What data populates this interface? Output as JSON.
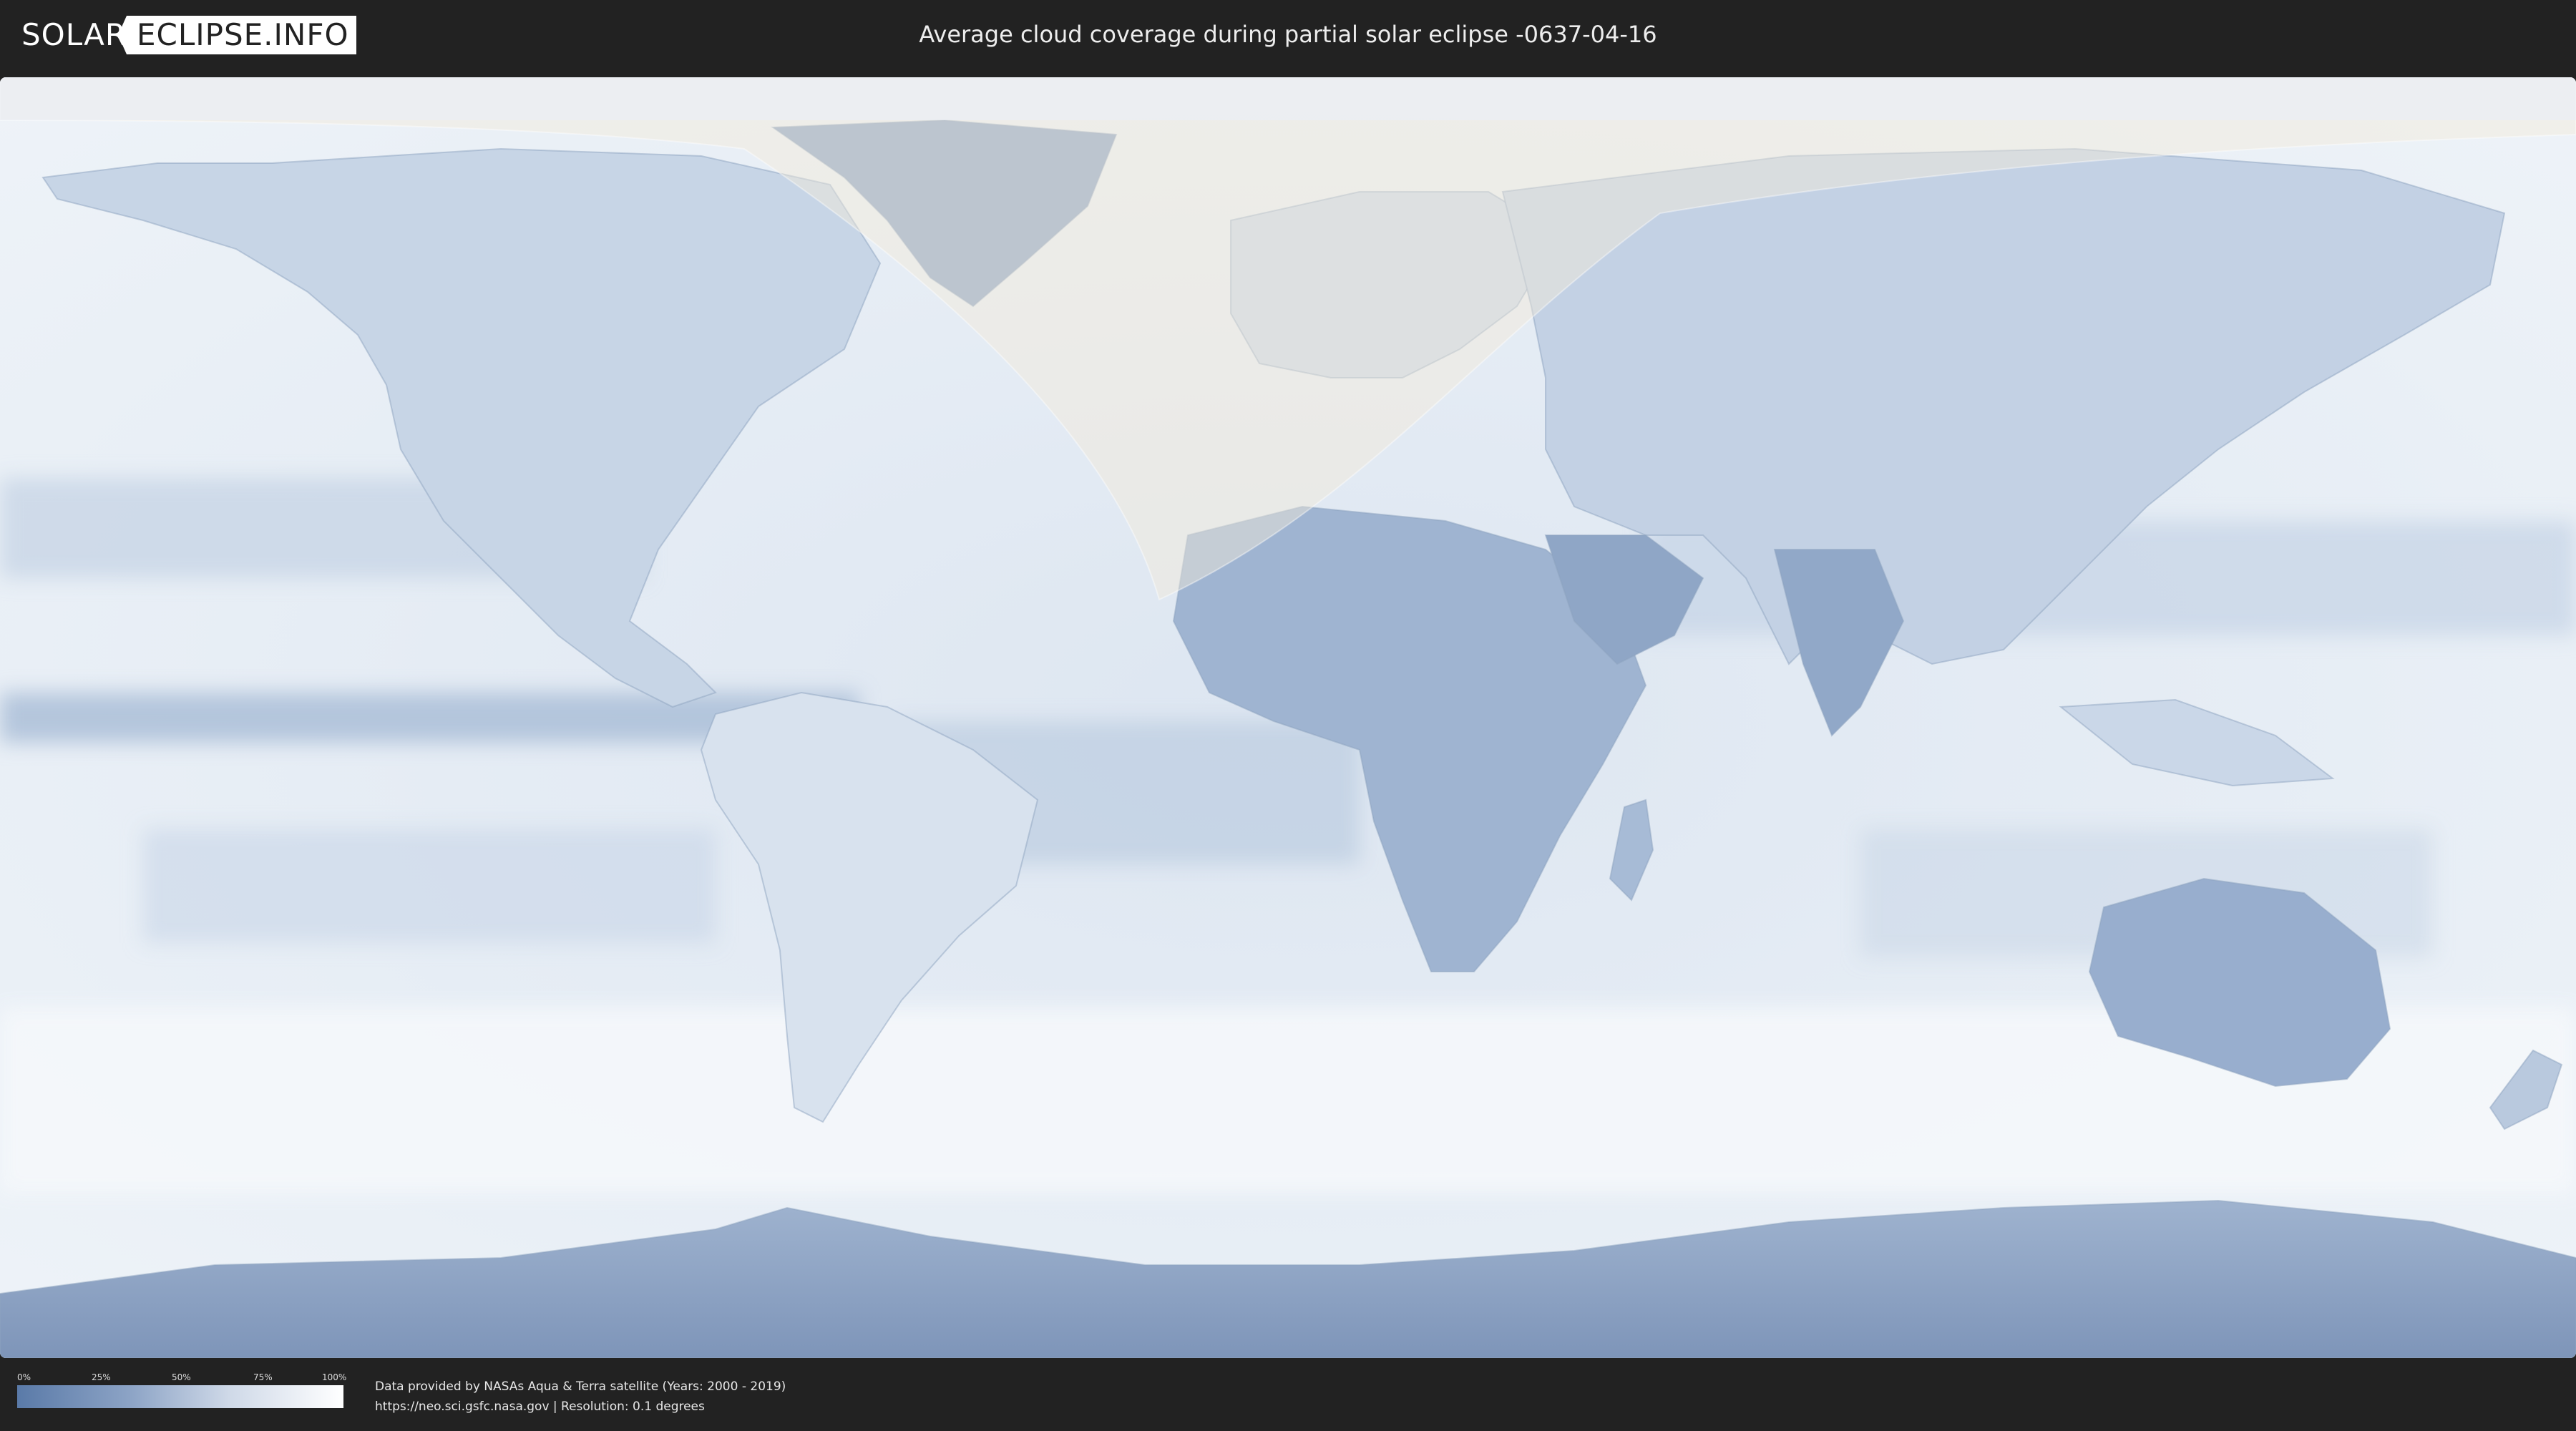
{
  "header": {
    "logo_left": "SOLAR",
    "logo_right": "ECLIPSE.INFO",
    "title": "Average cloud coverage during partial solar eclipse -0637-04-16"
  },
  "map": {
    "description_type": "world cloud coverage map (equirectangular)",
    "colors": {
      "clear_sky": "#5a7aa8",
      "full_cloud": "#ffffff",
      "eclipse_zone_tint": "#f3ead9"
    }
  },
  "legend": {
    "ticks": [
      "0%",
      "25%",
      "50%",
      "75%",
      "100%"
    ],
    "values": [
      0,
      25,
      50,
      75,
      100
    ],
    "unit": "%"
  },
  "footer": {
    "source_line1": "Data provided by NASAs Aqua & Terra satellite (Years: 2000 - 2019)",
    "source_line2": "https://neo.sci.gsfc.nasa.gov | Resolution: 0.1 degrees"
  }
}
